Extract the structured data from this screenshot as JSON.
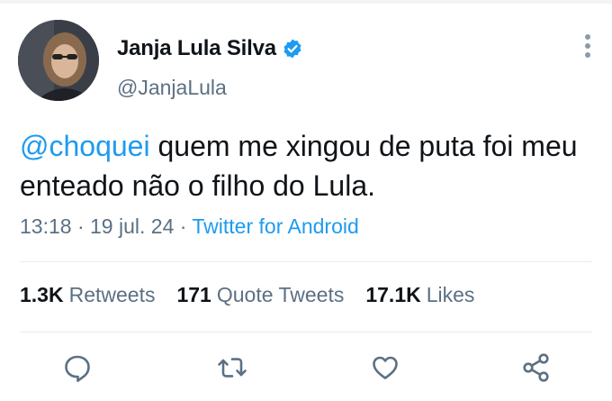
{
  "author": {
    "display_name": "Janja Lula Silva",
    "handle": "@JanjaLula",
    "verified": true
  },
  "tweet": {
    "mention": "@choquei",
    "text_after_mention": " quem me xingou de puta foi meu enteado não o filho do Lula."
  },
  "meta": {
    "time": "13:18",
    "sep1": " · ",
    "date": "19 jul. 24",
    "sep2": " · ",
    "source": "Twitter for Android"
  },
  "stats": {
    "retweets_count": "1.3K",
    "retweets_label": "Retweets",
    "quote_count": "171",
    "quote_label": "Quote Tweets",
    "likes_count": "17.1K",
    "likes_label": "Likes"
  },
  "icons": {
    "verified": "verified-badge-icon",
    "more": "more-vertical-icon",
    "reply": "reply-icon",
    "retweet": "retweet-icon",
    "like": "heart-icon",
    "share": "share-icon"
  },
  "colors": {
    "accent": "#1d9bf0",
    "secondary_text": "#5b7083",
    "primary_text": "#0f1419",
    "divider": "#e6ecf0"
  }
}
